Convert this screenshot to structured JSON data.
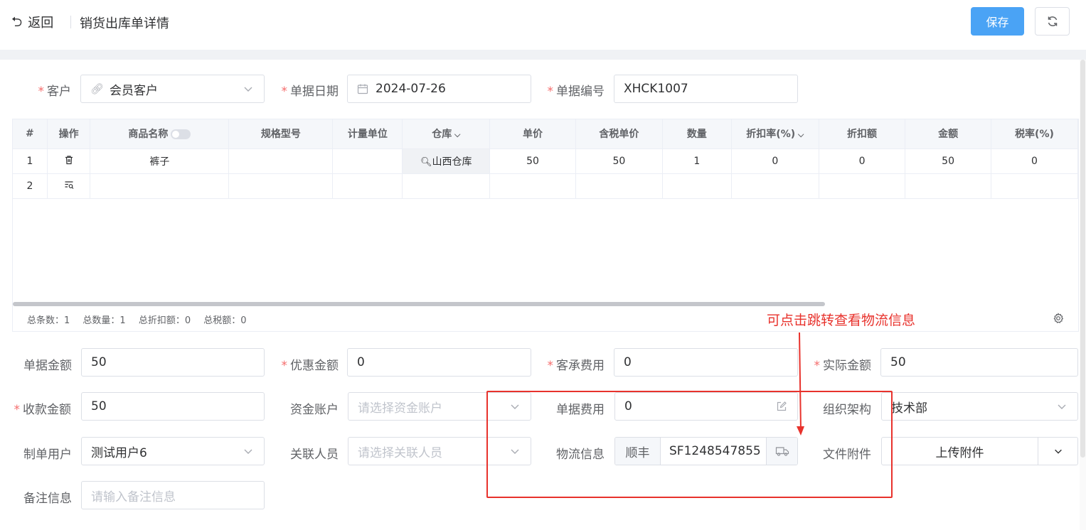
{
  "header": {
    "back_label": "返回",
    "title": "销货出库单详情",
    "save_label": "保存"
  },
  "form_top": {
    "customer_label": "客户",
    "customer_value": "会员客户",
    "date_label": "单据日期",
    "date_value": "2024-07-26",
    "number_label": "单据编号",
    "number_value": "XHCK1007"
  },
  "table": {
    "columns": [
      "#",
      "操作",
      "商品名称",
      "规格型号",
      "计量单位",
      "仓库",
      "单价",
      "含税单价",
      "数量",
      "折扣率(%)",
      "折扣额",
      "金额",
      "税率(%)"
    ],
    "rows": [
      {
        "index": "1",
        "product": "裤子",
        "spec": "",
        "unit": "",
        "warehouse": "山西仓库",
        "price": "50",
        "tax_price": "50",
        "qty": "1",
        "discount_rate": "0",
        "discount_amount": "0",
        "amount": "50",
        "tax_rate": "0"
      },
      {
        "index": "2",
        "product": "",
        "spec": "",
        "unit": "",
        "warehouse": "",
        "price": "",
        "tax_price": "",
        "qty": "",
        "discount_rate": "",
        "discount_amount": "",
        "amount": "",
        "tax_rate": ""
      }
    ],
    "summary": {
      "total_count": "总条数：1",
      "total_qty": "总数量：1",
      "total_discount": "总折扣额：0",
      "total_tax": "总税额：0"
    }
  },
  "form_bottom": {
    "bill_amount_label": "单据金额",
    "bill_amount_value": "50",
    "discount_amount_label": "优惠金额",
    "discount_amount_value": "0",
    "customer_fee_label": "客承费用",
    "customer_fee_value": "0",
    "actual_amount_label": "实际金额",
    "actual_amount_value": "50",
    "received_label": "收款金额",
    "received_value": "50",
    "account_label": "资金账户",
    "account_placeholder": "请选择资金账户",
    "bill_fee_label": "单据费用",
    "bill_fee_value": "0",
    "org_label": "组织架构",
    "org_value": "技术部",
    "creator_label": "制单用户",
    "creator_value": "测试用户6",
    "related_label": "关联人员",
    "related_placeholder": "请选择关联人员",
    "logistics_label": "物流信息",
    "logistics_carrier": "顺丰",
    "logistics_tracking": "SF1248547855",
    "attachment_label": "文件附件",
    "upload_label": "上传附件",
    "remark_label": "备注信息",
    "remark_placeholder": "请输入备注信息"
  },
  "annotation": {
    "text": "可点击跳转查看物流信息",
    "color": "#e8322c"
  },
  "colors": {
    "primary": "#4aa3f5",
    "required": "#f56c6c"
  }
}
